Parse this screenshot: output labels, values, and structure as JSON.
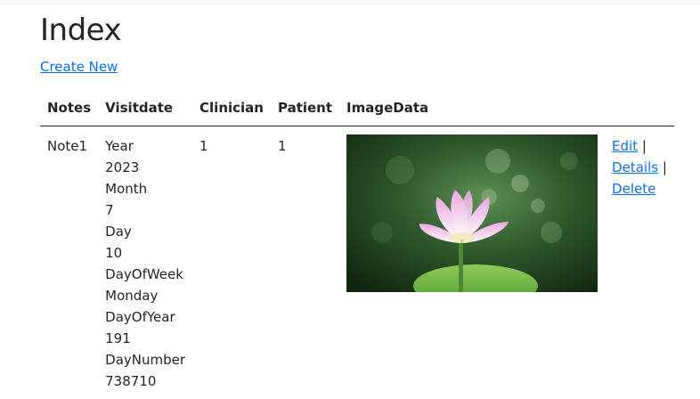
{
  "page": {
    "title": "Index",
    "create_new_label": "Create New"
  },
  "table": {
    "headers": [
      "Notes",
      "Visitdate",
      "Clinician",
      "Patient",
      "ImageData",
      ""
    ],
    "rows": [
      {
        "notes": "Note1",
        "visitdate_lines": [
          "Year",
          "2023",
          "Month",
          "7",
          "Day",
          "10",
          "DayOfWeek",
          "Monday",
          "DayOfYear",
          "191",
          "DayNumber",
          "738710"
        ],
        "clinician": "1",
        "patient": "1",
        "image_icon": "lotus-flower-photo",
        "actions": {
          "edit_label": "Edit",
          "details_label": "Details",
          "delete_label": "Delete",
          "separator": "|"
        }
      }
    ]
  },
  "colors": {
    "link": "#0d6efd",
    "text": "#212529"
  }
}
